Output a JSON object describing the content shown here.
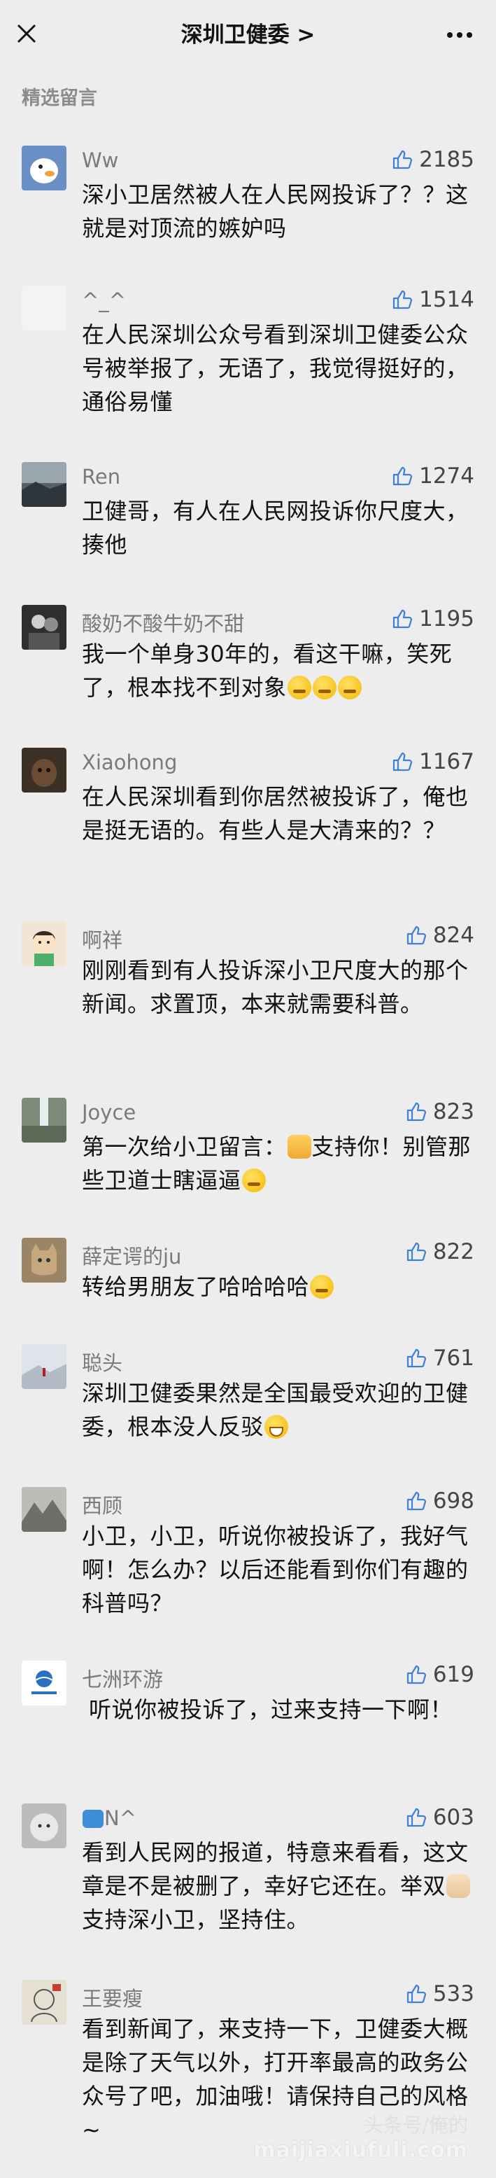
{
  "header": {
    "title": "深圳卫健委 >",
    "close_icon": "close-icon",
    "more_icon": "more-icon"
  },
  "section": {
    "label": "精选留言"
  },
  "comments": [
    {
      "nick": "Ww",
      "likes": "2185",
      "text": "深小卫居然被人在人民网投诉了？？这就是对顶流的嫉妒吗"
    },
    {
      "nick": "^_^",
      "likes": "1514",
      "text": "在人民深圳公众号看到深圳卫健委公众号被举报了，无语了，我觉得挺好的，通俗易懂"
    },
    {
      "nick": "Ren",
      "likes": "1274",
      "text": "卫健哥，有人在人民网投诉你尺度大，揍他"
    },
    {
      "nick": "酸奶不酸牛奶不甜",
      "likes": "1195",
      "text": "我一个单身30年的，看这干嘛，笑死了，根本找不到对象"
    },
    {
      "nick": "Xiaohong",
      "likes": "1167",
      "text": "在人民深圳看到你居然被投诉了，俺也是挺无语的。有些人是大清来的？？"
    },
    {
      "nick": "啊祥",
      "likes": "824",
      "text": "刚刚看到有人投诉深小卫尺度大的那个新闻。求置顶，本来就需要科普。"
    },
    {
      "nick": "Joyce",
      "likes": "823",
      "text_a": "第一次给小卫留言：",
      "text_b": "支持你！别管那些卫道士瞎逼逼"
    },
    {
      "nick": "薛定谔的ju",
      "likes": "822",
      "text": "转给男朋友了哈哈哈哈"
    },
    {
      "nick": "聪头",
      "likes": "761",
      "text": "深圳卫健委果然是全国最受欢迎的卫健委，根本没人反驳"
    },
    {
      "nick": "西顾",
      "likes": "698",
      "text": "小卫，小卫，听说你被投诉了，我好气啊！怎么办？以后还能看到你们有趣的科普吗？"
    },
    {
      "nick": "七洲环游",
      "likes": "619",
      "text": "听说你被投诉了，过来支持一下啊！"
    },
    {
      "nick": "N^",
      "likes": "603",
      "text_a": "看到人民网的报道，特意来看看，这文章是不是被删了，幸好它还在。举双",
      "text_b": "支持深小卫，坚持住。"
    },
    {
      "nick": "王要瘦",
      "likes": "533",
      "text": "看到新闻了，来支持一下，卫健委大概是除了天气以外，打开率最高的政务公众号了吧，加油哦！请保持自己的风格~"
    }
  ],
  "avatars": {
    "c0": {
      "bg": "#6a8fc4",
      "icon": "duck-avatar"
    },
    "c1": {
      "bg": "#f3f3f3",
      "icon": "blank-avatar"
    },
    "c2": {
      "bg": "#54606a",
      "icon": "landscape-avatar"
    },
    "c3": {
      "bg": "#2f2f2f",
      "icon": "couple-avatar"
    },
    "c4": {
      "bg": "#3a3026",
      "icon": "dog-avatar"
    },
    "c5": {
      "bg": "#f1e6d6",
      "icon": "cartoon-avatar"
    },
    "c6": {
      "bg": "#7d8a78",
      "icon": "waterfall-avatar"
    },
    "c7": {
      "bg": "#9c8466",
      "icon": "cat-avatar"
    },
    "c8": {
      "bg": "#c9cfd7",
      "icon": "snow-avatar"
    },
    "c9": {
      "bg": "#8a8a86",
      "icon": "mountain-avatar"
    },
    "c10": {
      "bg": "#ffffff",
      "icon": "logo-avatar"
    },
    "c11": {
      "bg": "#bcbcbc",
      "icon": "cat-avatar"
    },
    "c12": {
      "bg": "#e6e0d2",
      "icon": "sketch-avatar"
    }
  },
  "watermark": {
    "line1": "头条号/俺的",
    "line2": "maijiaxiufuli.com"
  }
}
